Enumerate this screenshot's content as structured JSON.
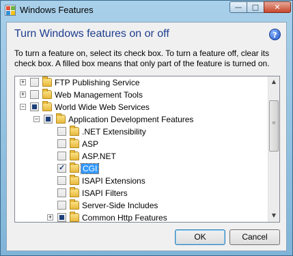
{
  "window": {
    "title": "Windows Features",
    "caption_buttons": {
      "minimize": "—",
      "maximize": "□",
      "close": "✕"
    }
  },
  "header": {
    "heading": "Turn Windows features on or off",
    "help_icon": "?",
    "description": "To turn a feature on, select its check box. To turn a feature off, clear its check box. A filled box means that only part of the feature is turned on."
  },
  "tree": {
    "items": [
      {
        "label": "FTP Publishing Service",
        "state": "unchecked",
        "expander": "+"
      },
      {
        "label": "Web Management Tools",
        "state": "unchecked",
        "expander": "+"
      },
      {
        "label": "World Wide Web Services",
        "state": "partial",
        "expander": "−"
      },
      {
        "label": "Application Development Features",
        "state": "partial",
        "expander": "−"
      },
      {
        "label": ".NET Extensibility",
        "state": "unchecked"
      },
      {
        "label": "ASP",
        "state": "unchecked"
      },
      {
        "label": "ASP.NET",
        "state": "unchecked"
      },
      {
        "label": "CGI",
        "state": "checked",
        "selected": true
      },
      {
        "label": "ISAPI Extensions",
        "state": "unchecked"
      },
      {
        "label": "ISAPI Filters",
        "state": "unchecked"
      },
      {
        "label": "Server-Side Includes",
        "state": "unchecked"
      },
      {
        "label": "Common Http Features",
        "state": "partial",
        "expander": "+"
      }
    ]
  },
  "scrollbar": {
    "up_arrow": "▲",
    "down_arrow": "▼",
    "grip": "≡"
  },
  "buttons": {
    "ok": "OK",
    "cancel": "Cancel"
  },
  "colors": {
    "heading": "#1e3d8f",
    "selection": "#3399ff",
    "partial_fill": "#1c3f7a"
  }
}
